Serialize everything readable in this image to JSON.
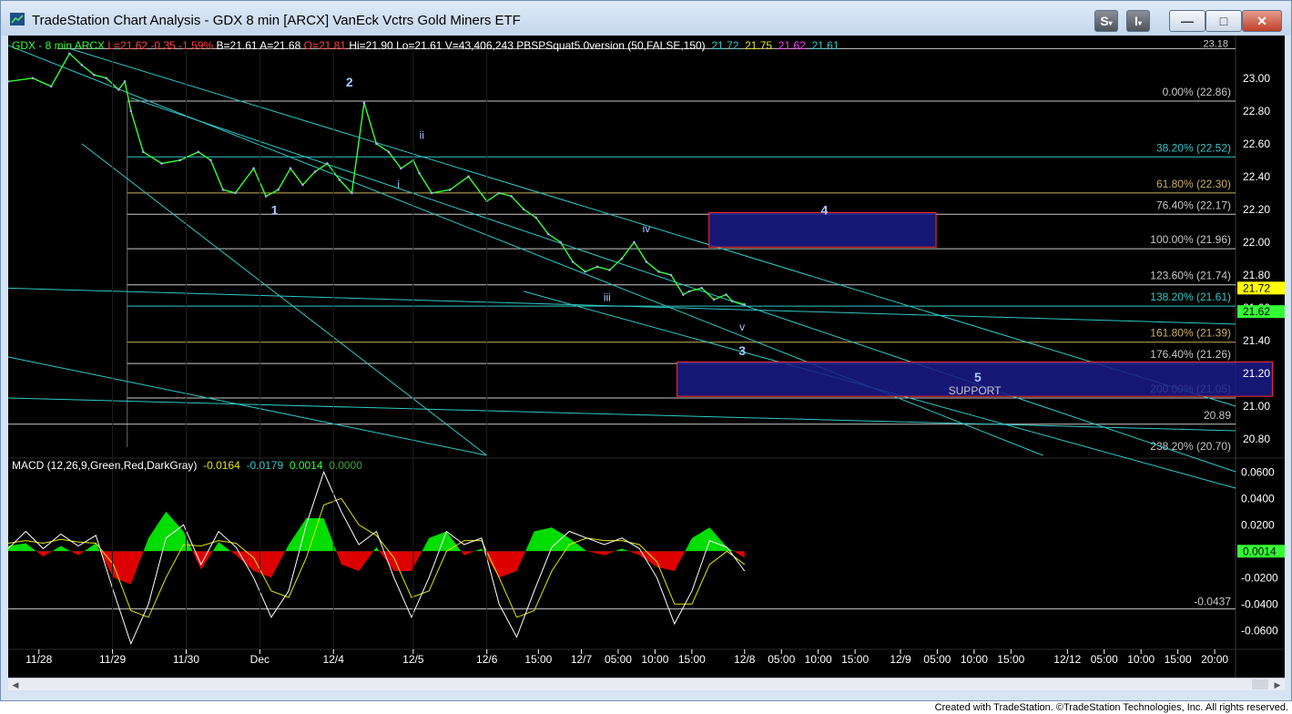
{
  "window": {
    "title": "TradeStation Chart Analysis - GDX 8 min [ARCX] VanEck Vctrs Gold Miners ETF",
    "buttons": {
      "s": "S",
      "i": "I",
      "minimize": "—",
      "maximize": "□",
      "close": "✕"
    }
  },
  "colors": {
    "background": "#000000",
    "price": "#33ff33",
    "guide": "#8dd0dc",
    "cyan": "#30c8c8",
    "fib_text": "#c8c8c8",
    "box_fill": "#1a1a8a",
    "box_border": "#ff3030",
    "hist_pos": "#00dd00",
    "hist_neg": "#dd0000",
    "macd_line": "#ffffff",
    "signal_line": "#e6e600"
  },
  "price_header": {
    "symbol": "GDX - 8 min",
    "exchange": "ARCX",
    "last": "L=21.62",
    "change": "-0.35",
    "pct": "-1.59%",
    "bid": "B=21.61",
    "ask": "A=21.68",
    "open": "O=21.81",
    "high": "Hi=21.90",
    "low": "Lo=21.61",
    "volume": "V=43,406,243",
    "indicator": "PBSPSquat5.0version (50,FALSE,150)",
    "ind_v1": "21.72",
    "ind_v2": "21.75",
    "ind_v3": "21.62",
    "ind_v4": "21.61"
  },
  "macd_header": {
    "label": "MACD (12,26,9,Green,Red,DarkGray)",
    "v1": "-0.0164",
    "v2": "-0.0179",
    "v3": "0.0014",
    "v4": "0.0000"
  },
  "price_axis": {
    "ticks": [
      23.0,
      22.8,
      22.6,
      22.4,
      22.2,
      22.0,
      21.8,
      21.6,
      21.4,
      21.2,
      21.0,
      20.8
    ],
    "labels": [
      "23.00",
      "22.80",
      "22.60",
      "22.40",
      "22.20",
      "22.00",
      "21.80",
      "21.60",
      "21.40",
      "21.20",
      "21.00",
      "20.80"
    ],
    "badge_upper": "21.72",
    "badge_lower": "21.62",
    "badge_upper_bg": "#ffff00",
    "badge_lower_bg": "#33ff33",
    "range": [
      20.7,
      23.16
    ]
  },
  "macd_axis": {
    "ticks": [
      0.06,
      0.04,
      0.02,
      0.0,
      -0.02,
      -0.04,
      -0.06
    ],
    "labels": [
      "0.0600",
      "0.0400",
      "0.0200",
      "0.0014",
      "-0.0200",
      "-0.0400",
      "-0.0600"
    ],
    "current": "0.0014",
    "ref_value": "-0.0437",
    "range": [
      -0.075,
      0.065
    ]
  },
  "fib_levels": [
    {
      "label": "0.00% (22.86)",
      "price": 22.86,
      "color": "#c8c8c8"
    },
    {
      "label": "38.20% (22.52)",
      "price": 22.52,
      "color": "#30c8c8"
    },
    {
      "label": "61.80% (22.30)",
      "price": 22.3,
      "color": "#c8b060"
    },
    {
      "label": "76.40% (22.17)",
      "price": 22.17,
      "color": "#c8c8c8"
    },
    {
      "label": "100.00% (21.96)",
      "price": 21.96,
      "color": "#c8c8c8"
    },
    {
      "label": "123.60% (21.74)",
      "price": 21.74,
      "color": "#c8c8c8"
    },
    {
      "label": "138.20% (21.61)",
      "price": 21.61,
      "color": "#30c8c8"
    },
    {
      "label": "161.80% (21.39)",
      "price": 21.39,
      "color": "#c8b060"
    },
    {
      "label": "176.40% (21.26)",
      "price": 21.26,
      "color": "#c8c8c8"
    },
    {
      "label": "200.00% (21.05)",
      "price": 21.05,
      "color": "#c8c8c8"
    },
    {
      "label": "238.20% (20.70)",
      "price": 20.7,
      "color": "#c8c8c8"
    }
  ],
  "extra_level": {
    "label": "20.89",
    "price": 20.89
  },
  "top_level": {
    "label": "23.18",
    "price": 23.18
  },
  "wave_labels": [
    {
      "text": "2",
      "t": 0.278,
      "price": 22.95,
      "size": 14
    },
    {
      "text": "1",
      "t": 0.217,
      "price": 22.17,
      "size": 14
    },
    {
      "text": "ii",
      "t": 0.337,
      "price": 22.63,
      "size": 12
    },
    {
      "text": "i",
      "t": 0.318,
      "price": 22.33,
      "size": 12
    },
    {
      "text": "iv",
      "t": 0.52,
      "price": 22.06,
      "size": 12
    },
    {
      "text": "iii",
      "t": 0.488,
      "price": 21.64,
      "size": 12
    },
    {
      "text": "v",
      "t": 0.598,
      "price": 21.46,
      "size": 12
    },
    {
      "text": "3",
      "t": 0.598,
      "price": 21.31,
      "size": 14
    },
    {
      "text": "4",
      "t": 0.665,
      "price": 22.17,
      "size": 14
    },
    {
      "text": "5",
      "t": 0.79,
      "price": 21.15,
      "size": 14
    }
  ],
  "target_boxes": [
    {
      "name": "wave-4-box",
      "t0": 0.571,
      "t1": 0.756,
      "p_top": 22.18,
      "p_bottom": 21.97
    },
    {
      "name": "wave-5-support-box",
      "t0": 0.545,
      "t1": 1.03,
      "p_top": 21.27,
      "p_bottom": 21.06,
      "label": "SUPPORT"
    }
  ],
  "time_axis": {
    "labels": [
      "11/28",
      "11/29",
      "11/30",
      "Dec",
      "12/4",
      "12/5",
      "12/6",
      "15:00",
      "12/7",
      "05:00",
      "10:00",
      "15:00",
      "12/8",
      "05:00",
      "10:00",
      "15:00",
      "12/9",
      "05:00",
      "10:00",
      "15:00",
      "12/12",
      "05:00",
      "10:00",
      "15:00",
      "20:00"
    ],
    "positions": [
      0.025,
      0.085,
      0.145,
      0.205,
      0.265,
      0.33,
      0.39,
      0.432,
      0.467,
      0.497,
      0.527,
      0.557,
      0.6,
      0.63,
      0.66,
      0.69,
      0.727,
      0.757,
      0.787,
      0.817,
      0.863,
      0.893,
      0.923,
      0.953,
      0.983
    ]
  },
  "chart_data": {
    "type": "line",
    "title": "GDX - 8 min",
    "xlabel": "",
    "ylabel": "",
    "ylim": [
      20.7,
      23.16
    ],
    "series": [
      {
        "name": "GDX - 8 min",
        "x": [
          0.0,
          0.02,
          0.035,
          0.05,
          0.06,
          0.07,
          0.08,
          0.09,
          0.095,
          0.1,
          0.11,
          0.125,
          0.14,
          0.155,
          0.165,
          0.175,
          0.185,
          0.2,
          0.21,
          0.22,
          0.23,
          0.24,
          0.25,
          0.26,
          0.27,
          0.28,
          0.29,
          0.3,
          0.31,
          0.32,
          0.33,
          0.335,
          0.345,
          0.36,
          0.375,
          0.39,
          0.4,
          0.41,
          0.42,
          0.43,
          0.44,
          0.45,
          0.46,
          0.47,
          0.48,
          0.49,
          0.5,
          0.51,
          0.52,
          0.53,
          0.54,
          0.55,
          0.555,
          0.565,
          0.575,
          0.585,
          0.59,
          0.6
        ],
        "values": [
          22.98,
          23.0,
          22.95,
          23.15,
          23.08,
          23.02,
          23.0,
          22.93,
          22.98,
          22.8,
          22.55,
          22.48,
          22.5,
          22.55,
          22.5,
          22.32,
          22.3,
          22.45,
          22.28,
          22.32,
          22.45,
          22.35,
          22.43,
          22.48,
          22.38,
          22.3,
          22.85,
          22.6,
          22.55,
          22.45,
          22.5,
          22.42,
          22.3,
          22.32,
          22.4,
          22.25,
          22.3,
          22.28,
          22.2,
          22.15,
          22.05,
          22.0,
          21.88,
          21.82,
          21.85,
          21.83,
          21.9,
          22.0,
          21.88,
          21.82,
          21.8,
          21.68,
          21.7,
          21.72,
          21.65,
          21.68,
          21.64,
          21.62
        ]
      }
    ],
    "macd": {
      "macd_line": [
        0.002,
        0.015,
        0.002,
        0.013,
        0.004,
        0.012,
        -0.03,
        -0.07,
        -0.04,
        0.01,
        0.02,
        -0.01,
        0.015,
        0.003,
        -0.02,
        -0.05,
        -0.03,
        0.02,
        0.06,
        0.03,
        0.005,
        0.015,
        -0.02,
        -0.05,
        -0.02,
        0.015,
        0.005,
        0.01,
        -0.04,
        -0.065,
        -0.03,
        0.003,
        0.015,
        0.01,
        0.005,
        0.01,
        0.002,
        -0.02,
        -0.055,
        -0.03,
        0.008,
        0.003,
        -0.015
      ],
      "signal_line": [
        0.006,
        0.008,
        0.006,
        0.009,
        0.007,
        0.006,
        -0.01,
        -0.045,
        -0.05,
        -0.02,
        0.005,
        0.004,
        0.008,
        0.006,
        -0.005,
        -0.03,
        -0.035,
        -0.005,
        0.035,
        0.04,
        0.02,
        0.012,
        -0.005,
        -0.035,
        -0.03,
        0.0,
        0.008,
        0.008,
        -0.02,
        -0.05,
        -0.045,
        -0.015,
        0.005,
        0.01,
        0.008,
        0.008,
        0.005,
        -0.008,
        -0.04,
        -0.04,
        -0.01,
        0.0,
        -0.01
      ],
      "histogram": [
        0.004,
        0.006,
        -0.004,
        0.004,
        -0.003,
        0.006,
        -0.02,
        -0.025,
        0.01,
        0.03,
        0.015,
        -0.014,
        0.007,
        -0.003,
        -0.015,
        -0.02,
        0.005,
        0.025,
        0.025,
        -0.01,
        -0.015,
        0.003,
        -0.015,
        -0.015,
        0.01,
        0.015,
        -0.003,
        0.002,
        -0.02,
        -0.015,
        0.015,
        0.018,
        0.01,
        0.0,
        -0.003,
        0.002,
        -0.003,
        -0.012,
        -0.015,
        0.01,
        0.018,
        0.003,
        -0.005
      ],
      "zero": 0.0
    }
  }
}
